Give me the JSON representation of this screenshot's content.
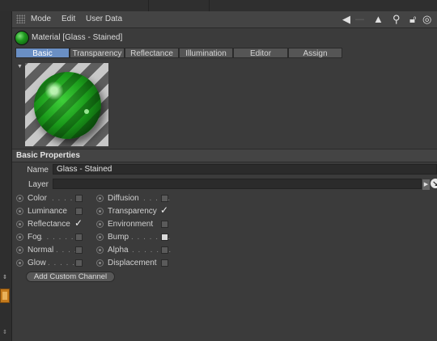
{
  "menu": {
    "items": [
      "Mode",
      "Edit",
      "User Data"
    ],
    "icons": [
      "back-arrow-icon",
      "up-arrow-icon",
      "search-icon",
      "lock-icon",
      "target-icon"
    ]
  },
  "material": {
    "title": "Material [Glass - Stained]"
  },
  "tabs": [
    {
      "label": "Basic",
      "active": true
    },
    {
      "label": "Transparency",
      "active": false
    },
    {
      "label": "Reflectance",
      "active": false
    },
    {
      "label": "Illumination",
      "active": false
    },
    {
      "label": "Editor",
      "active": false
    },
    {
      "label": "Assign",
      "active": false
    }
  ],
  "section": {
    "title": "Basic Properties"
  },
  "fields": {
    "name_label": "Name",
    "name_value": "Glass - Stained",
    "layer_label": "Layer",
    "layer_value": ""
  },
  "channels_left": [
    {
      "label": "Color",
      "dots": ". . . . .",
      "checked": false
    },
    {
      "label": "Luminance",
      "dots": "",
      "checked": false
    },
    {
      "label": "Reflectance",
      "dots": "",
      "checked": true
    },
    {
      "label": "Fog",
      "dots": ". . . . . . .",
      "checked": false
    },
    {
      "label": "Normal",
      "dots": ". . . .",
      "checked": false
    },
    {
      "label": "Glow",
      "dots": ". . . . . .",
      "checked": false
    }
  ],
  "channels_right": [
    {
      "label": "Diffusion",
      "dots": ". . . . .",
      "checked": false
    },
    {
      "label": "Transparency",
      "dots": "",
      "checked": true
    },
    {
      "label": "Environment",
      "dots": "",
      "checked": false
    },
    {
      "label": "Bump",
      "dots": ". . . . . . .",
      "checked": false
    },
    {
      "label": "Alpha",
      "dots": ". . . . . . .",
      "checked": false
    },
    {
      "label": "Displacement",
      "dots": "",
      "checked": false
    }
  ],
  "buttons": {
    "add_channel": "Add Custom Channel"
  },
  "colors": {
    "tab_active": "#6a8fc4",
    "material_green": "#1a9a1a"
  }
}
